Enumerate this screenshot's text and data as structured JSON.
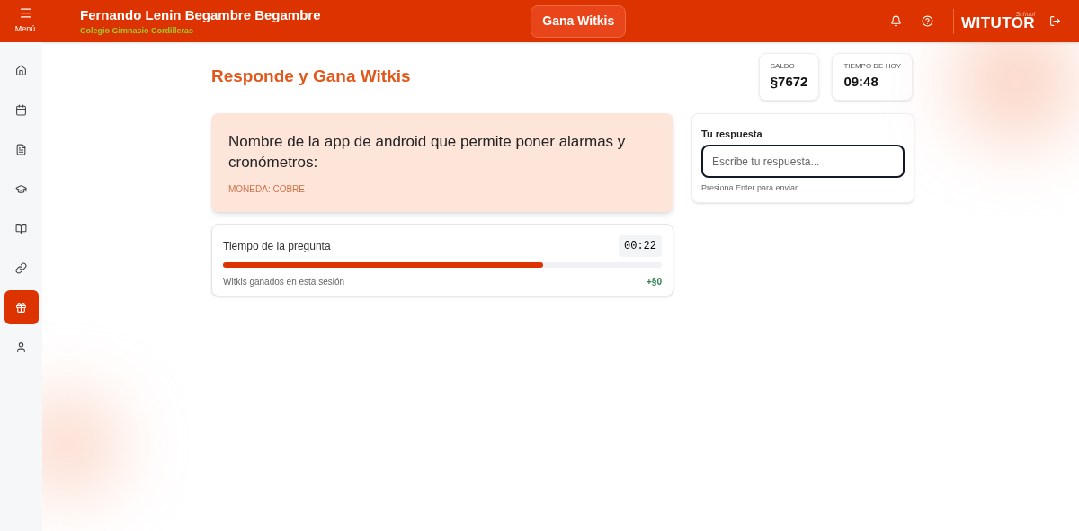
{
  "header": {
    "menu_label": "Menú",
    "user_name": "Fernando Lenin Begambre Begambre",
    "school": "Colegio Gimnasio Cordilleras",
    "center_button": "Gana Witkis",
    "logo": "WITUTOR",
    "logo_script": "School"
  },
  "sidebar": {
    "items": [
      {
        "kind": "home",
        "selected": false
      },
      {
        "kind": "calendar",
        "selected": false
      },
      {
        "kind": "document",
        "selected": false
      },
      {
        "kind": "graduation",
        "selected": false
      },
      {
        "kind": "book",
        "selected": false
      },
      {
        "kind": "link",
        "selected": false
      },
      {
        "kind": "gift",
        "selected": true
      },
      {
        "kind": "user",
        "selected": false
      }
    ]
  },
  "page_title": "Responde y Gana Witkis",
  "stats": [
    {
      "label": "SALDO",
      "value": "§7672"
    },
    {
      "label": "TIEMPO DE HOY",
      "value": "09:48"
    }
  ],
  "question": {
    "text": "Nombre de la app de android que permite poner alarmas y cronómetros:",
    "currency": "MONEDA: COBRE"
  },
  "timer": {
    "label": "Tiempo de la pregunta",
    "time": "00:22",
    "level": 0.73,
    "earned_label": "Witkis ganados en esta sesión",
    "earned_value": "+§0"
  },
  "answer": {
    "label": "Tu respuesta",
    "placeholder": "Escribe tu respuesta...",
    "hint": "Presiona Enter para enviar"
  }
}
